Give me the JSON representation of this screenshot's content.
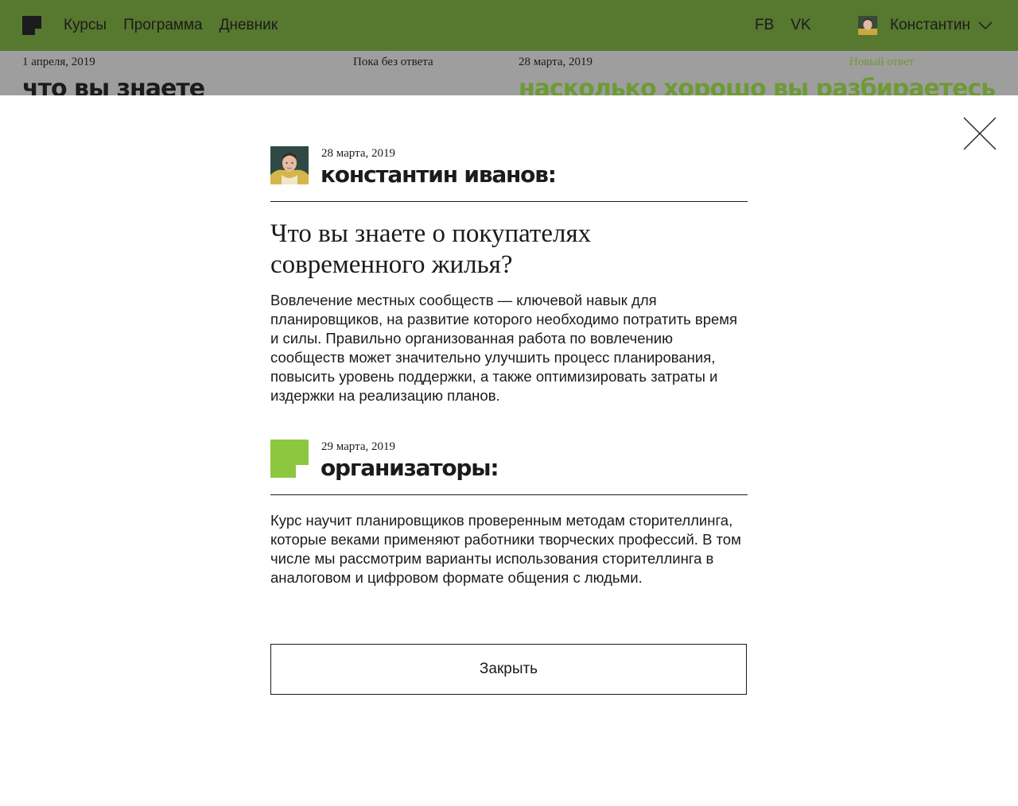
{
  "nav": {
    "items": [
      "Курсы",
      "Программа",
      "Дневник"
    ],
    "social": [
      "FB",
      "VK"
    ],
    "user_name": "Константин"
  },
  "background": {
    "cards": [
      {
        "date": "1 апреля, 2019",
        "status": "Пока без ответа",
        "title": "что вы знаете"
      },
      {
        "date": "28 марта, 2019",
        "status": "Новый ответ",
        "title": "насколько хорошо вы разбираетесь"
      }
    ]
  },
  "modal": {
    "message": {
      "date": "28 марта, 2019",
      "author": "константин иванов:",
      "question": "Что вы знаете о покупателях современного жилья?",
      "body": "Вовлечение местных сообществ — ключевой навык для планировщиков, на развитие которого необходимо потратить время и силы. Правильно организованная работа по вовлечению сообществ может значительно улучшить процесс планирования, повысить уровень поддержки, а также оптимизировать затраты и издержки на реализацию планов."
    },
    "reply": {
      "date": "29 марта, 2019",
      "author": "организаторы:",
      "body": "Курс научит планировщиков проверенным методам сторителлинга, которые веками применяют работники творческих профессий. В том числе мы рассмотрим варианты использования сторителлинга в аналоговом и цифровом формате общения с людьми."
    },
    "close_label": "Закрыть"
  },
  "colors": {
    "header_green": "#56782f",
    "accent_green": "#8dc63f",
    "text_dark": "#1b1b1b",
    "dim_gray": "#9e9e9e"
  },
  "icons": {
    "logo": "brand-logo-icon",
    "close": "close-icon",
    "chevron": "chevron-down-icon"
  }
}
